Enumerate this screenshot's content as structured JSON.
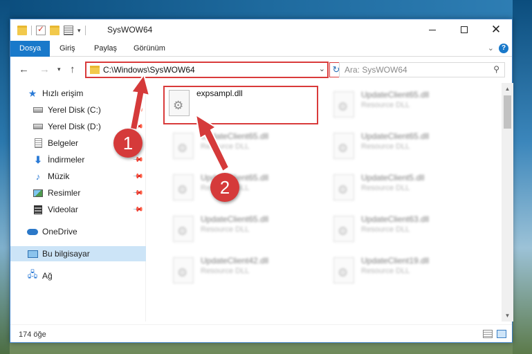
{
  "window": {
    "title": "SysWOW64"
  },
  "ribbon": {
    "tabs": [
      "Dosya",
      "Giriş",
      "Paylaş",
      "Görünüm"
    ],
    "active_tab": "Dosya",
    "help": "?"
  },
  "address": {
    "path": "C:\\Windows\\SysWOW64",
    "search_placeholder": "Ara: SysWOW64"
  },
  "sidebar": {
    "items": [
      {
        "label": "Hızlı erişim",
        "icon": "star-icon"
      },
      {
        "label": "Yerel Disk (C:)",
        "icon": "drive-icon",
        "pinned": true
      },
      {
        "label": "Yerel Disk (D:)",
        "icon": "drive-icon",
        "pinned": true
      },
      {
        "label": "Belgeler",
        "icon": "documents-icon",
        "pinned": true
      },
      {
        "label": "İndirmeler",
        "icon": "downloads-icon",
        "pinned": true
      },
      {
        "label": "Müzik",
        "icon": "music-icon",
        "pinned": true
      },
      {
        "label": "Resimler",
        "icon": "pictures-icon",
        "pinned": true
      },
      {
        "label": "Videolar",
        "icon": "videos-icon",
        "pinned": true
      },
      {
        "label": "OneDrive",
        "icon": "onedrive-icon"
      },
      {
        "label": "Bu bilgisayar",
        "icon": "this-pc-icon",
        "selected": true
      },
      {
        "label": "Ağ",
        "icon": "network-icon"
      }
    ]
  },
  "files": {
    "highlighted": {
      "name": "expsampl.dll"
    },
    "others": [
      {
        "name": "UpdateClient65.dll",
        "type": "Resource DLL"
      },
      {
        "name": "UpdateClient65.dll",
        "type": "Resource DLL"
      },
      {
        "name": "UpdateClient65.dll",
        "type": "Resource DLL"
      },
      {
        "name": "UpdateClient65.dll",
        "type": "Resource DLL"
      },
      {
        "name": "UpdateClient65.dll",
        "type": "Resource DLL"
      },
      {
        "name": "UpdateClient5.dll",
        "type": "Resource DLL"
      },
      {
        "name": "UpdateClient65.dll",
        "type": "Resource DLL"
      },
      {
        "name": "UpdateClient63.dll",
        "type": "Resource DLL"
      },
      {
        "name": "UpdateClient42.dll",
        "type": "Resource DLL"
      },
      {
        "name": "UpdateClient19.dll",
        "type": "Resource DLL"
      }
    ]
  },
  "status": {
    "count": "174 öğe"
  },
  "annotations": {
    "step1": "1",
    "step2": "2",
    "color": "#d53a3a"
  }
}
